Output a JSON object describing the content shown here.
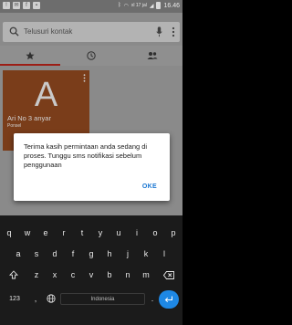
{
  "status_bar": {
    "network": "xl 17 jal",
    "time": "16.46",
    "icons": [
      "notification-icon",
      "mail-icon",
      "facebook-icon",
      "image-icon",
      "bluetooth-icon",
      "wifi-icon",
      "signal-icon",
      "battery-icon"
    ]
  },
  "search": {
    "placeholder": "Telusuri kontak"
  },
  "tabs": [
    {
      "icon": "star-icon",
      "active": true
    },
    {
      "icon": "clock-icon",
      "active": false
    },
    {
      "icon": "people-icon",
      "active": false
    }
  ],
  "contact": {
    "initial": "A",
    "name": "Ari No 3 anyar",
    "subtitle": "Ponsel"
  },
  "dialog": {
    "message": "Terima kasih permintaan anda sedang di proses. Tunggu sms notifikasi sebelum penggunaan",
    "ok_label": "OKE"
  },
  "keyboard": {
    "row1": [
      "q",
      "w",
      "e",
      "r",
      "t",
      "y",
      "u",
      "i",
      "o",
      "p"
    ],
    "row2": [
      "a",
      "s",
      "d",
      "f",
      "g",
      "h",
      "j",
      "k",
      "l"
    ],
    "row3": [
      "z",
      "x",
      "c",
      "v",
      "b",
      "n",
      "m"
    ],
    "numbers_label": "123",
    "comma": ",",
    "period": ".",
    "space_label": "Indonesia"
  },
  "colors": {
    "accent": "#9c1e16",
    "dialog_button": "#1976d2",
    "enter_key": "#1e88e5",
    "contact_card": "#7a3d1a"
  }
}
